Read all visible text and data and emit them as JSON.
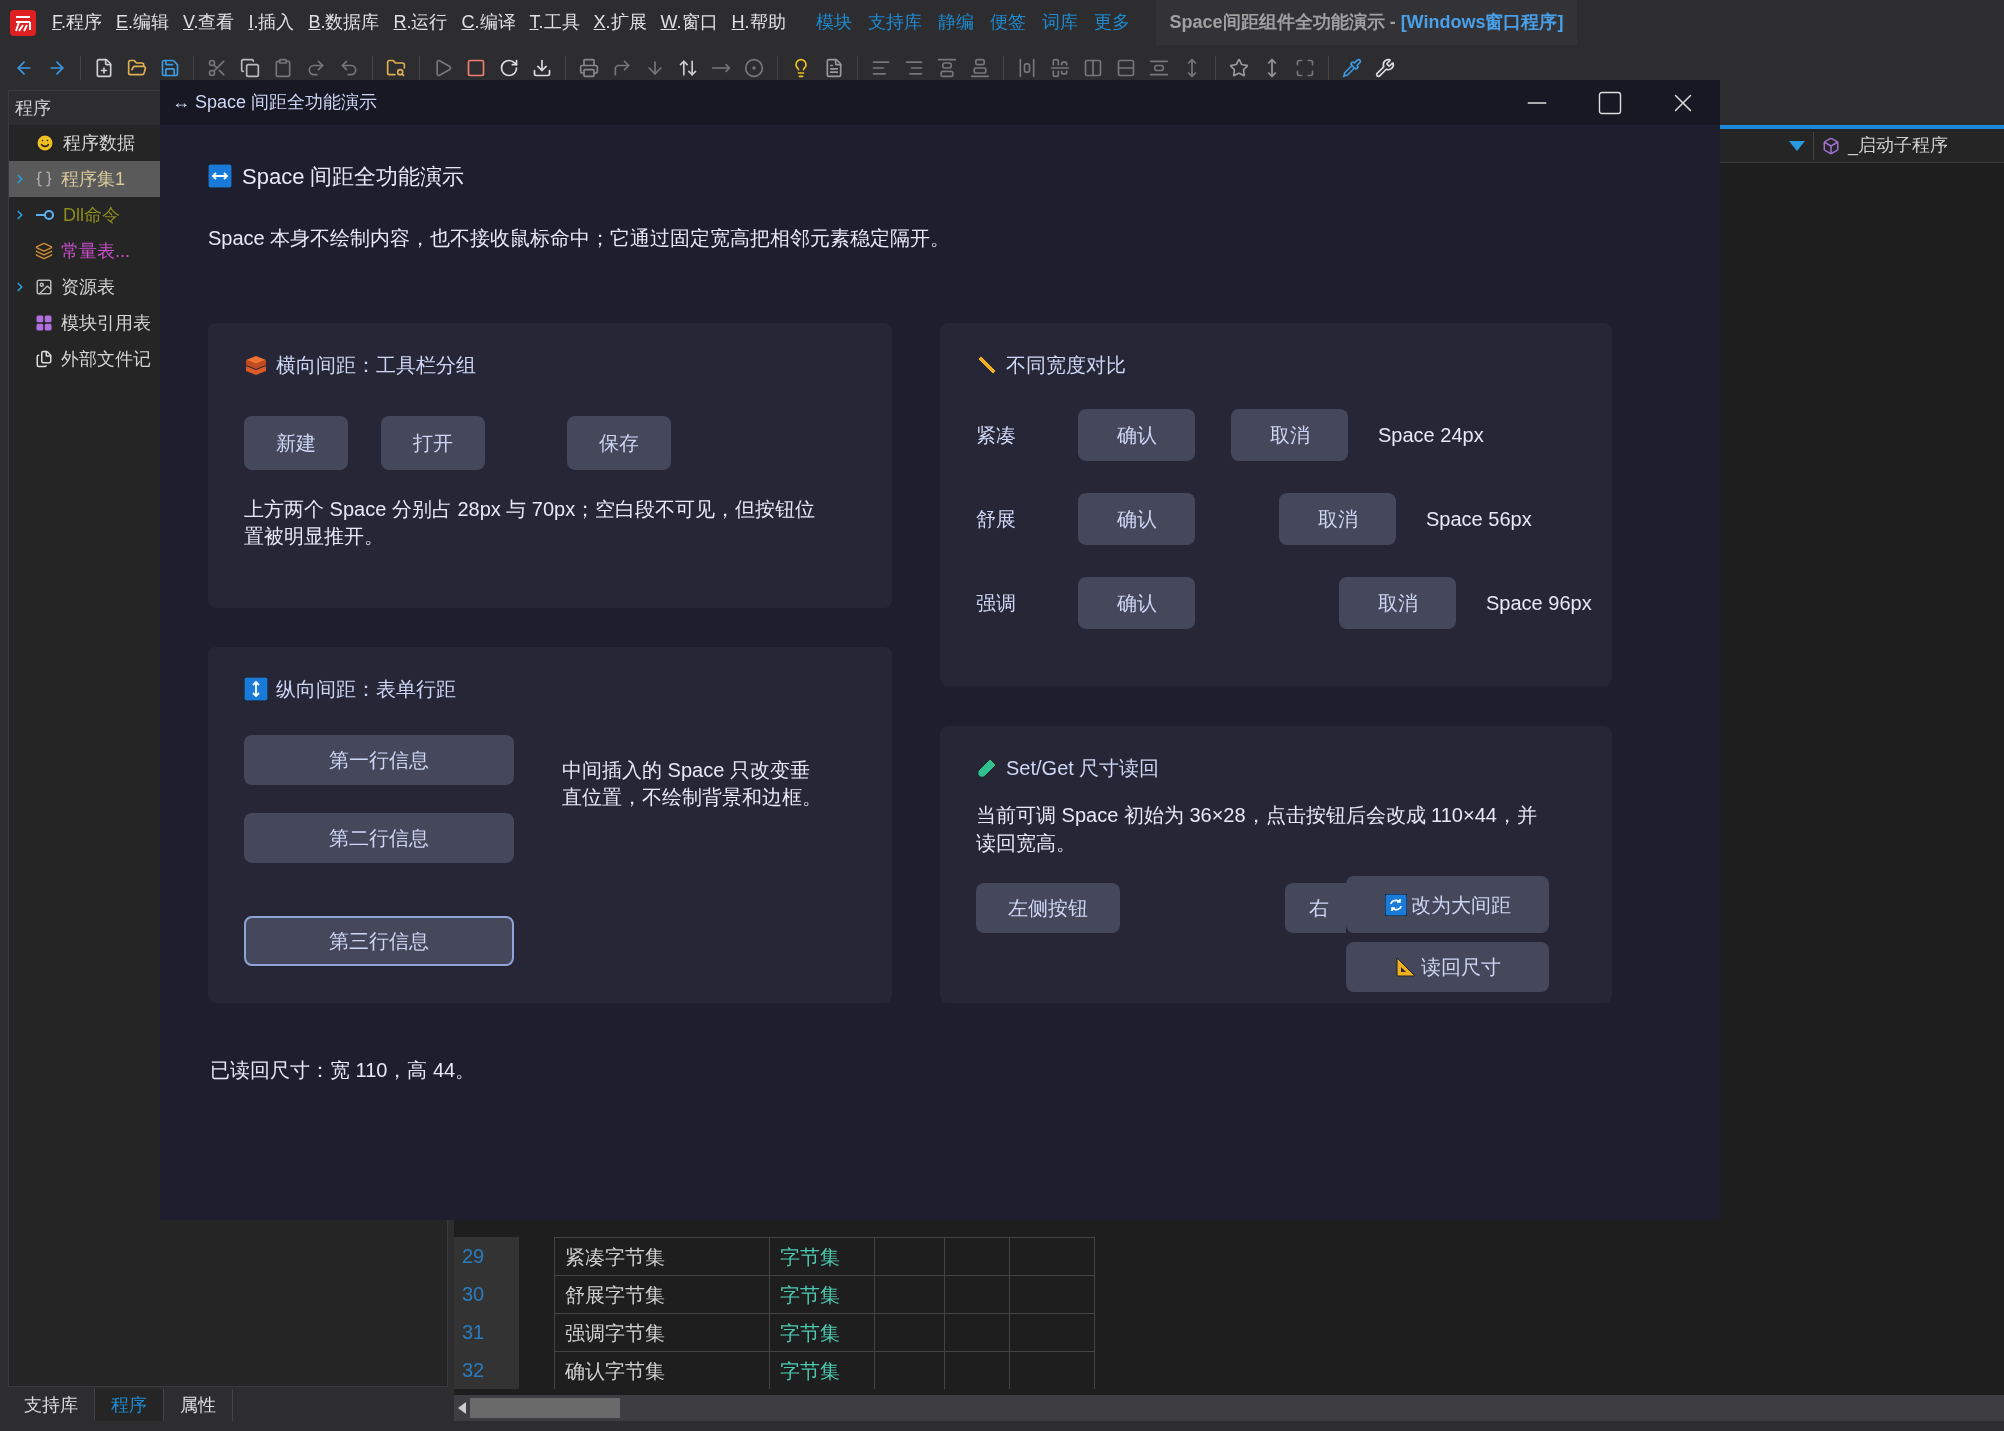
{
  "menu_bar": {
    "menus": [
      "F.程序",
      "E.编辑",
      "V.查看",
      "I.插入",
      "B.数据库",
      "R.运行",
      "C.编译",
      "T.工具",
      "X.扩展",
      "W.窗口",
      "H.帮助"
    ],
    "links": [
      "模块",
      "支持库",
      "静编",
      "便签",
      "词库",
      "更多"
    ],
    "document_tab": {
      "title": "Space间距组件全功能演示 - ",
      "kind": "[Windows窗口程序]"
    }
  },
  "sidebar": {
    "title": "程序",
    "items": [
      {
        "label": "程序数据",
        "color": "#d4d4d4",
        "expandable": false,
        "selected": false
      },
      {
        "label": "程序集1",
        "color": "#d8c89a",
        "expandable": true,
        "selected": true
      },
      {
        "label": "Dll命令",
        "color": "#8c8c1c",
        "expandable": true,
        "selected": false
      },
      {
        "label": "常量表...",
        "color": "#c84fc8",
        "expandable": false,
        "selected": false
      },
      {
        "label": "资源表",
        "color": "#d4d4d4",
        "expandable": true,
        "selected": false
      },
      {
        "label": "模块引用表",
        "color": "#d4d4d4",
        "expandable": false,
        "selected": false
      },
      {
        "label": "外部文件记",
        "color": "#d4d4d4",
        "expandable": false,
        "selected": false
      }
    ],
    "tabs": [
      {
        "label": "支持库",
        "selected": false
      },
      {
        "label": "程序",
        "selected": true
      },
      {
        "label": "属性",
        "selected": false
      }
    ]
  },
  "editor": {
    "procedure": "_启动子程序",
    "rows": [
      {
        "line": "29",
        "name": "紧凑字节集",
        "type": "字节集"
      },
      {
        "line": "30",
        "name": "舒展字节集",
        "type": "字节集"
      },
      {
        "line": "31",
        "name": "强调字节集",
        "type": "字节集"
      },
      {
        "line": "32",
        "name": "确认字节集",
        "type": "字节集"
      }
    ]
  },
  "dialog": {
    "title": "↔ Space 间距全功能演示",
    "heading": "Space 间距全功能演示",
    "description": "Space 本身不绘制内容，也不接收鼠标命中；它通过固定宽高把相邻元素稳定隔开。",
    "horizontal_card": {
      "title": "横向间距：工具栏分组",
      "buttons": [
        "新建",
        "打开",
        "保存"
      ],
      "note": "上方两个 Space 分别占 28px 与 70px；空白段不可见，但按钮位置被明显推开。"
    },
    "width_card": {
      "title": "不同宽度对比",
      "rows": [
        {
          "label": "紧凑",
          "confirm": "确认",
          "cancel": "取消",
          "reading": "Space 24px"
        },
        {
          "label": "舒展",
          "confirm": "确认",
          "cancel": "取消",
          "reading": "Space 56px"
        },
        {
          "label": "强调",
          "confirm": "确认",
          "cancel": "取消",
          "reading": "Space 96px"
        }
      ]
    },
    "vertical_card": {
      "title": "纵向间距：表单行距",
      "buttons": [
        {
          "label": "第一行信息",
          "focused": false
        },
        {
          "label": "第二行信息",
          "focused": false
        },
        {
          "label": "第三行信息",
          "focused": true
        }
      ],
      "note": "中间插入的 Space 只改变垂直位置，不绘制背景和边框。"
    },
    "setget_card": {
      "title": "Set/Get 尺寸读回",
      "text": "当前可调 Space 初始为 36×28，点击按钮后会改成 110×44，并读回宽高。",
      "left_button": "左侧按钮",
      "right_button": "右",
      "enlarge_button": "改为大间距",
      "read_button": "读回尺寸"
    },
    "result": "已读回尺寸：宽 110，高 44。"
  }
}
